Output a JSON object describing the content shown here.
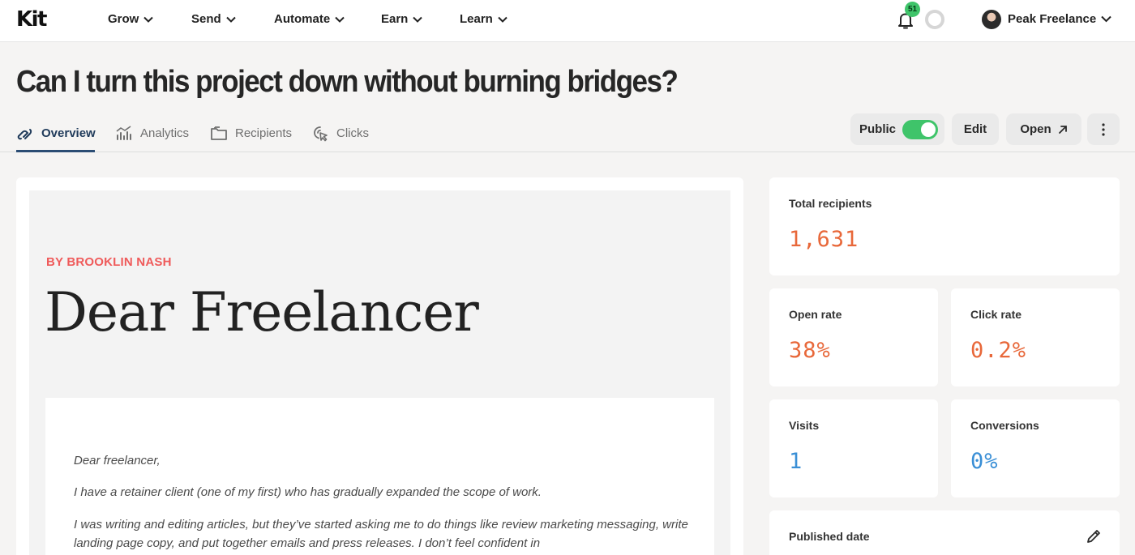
{
  "nav": {
    "logo": "Kit",
    "items": [
      {
        "label": "Grow"
      },
      {
        "label": "Send"
      },
      {
        "label": "Automate"
      },
      {
        "label": "Earn"
      },
      {
        "label": "Learn"
      }
    ],
    "notification_count": "51",
    "account_name": "Peak Freelance"
  },
  "page": {
    "title": "Can I turn this project down without burning bridges?"
  },
  "tabs": [
    {
      "label": "Overview",
      "icon": "link-icon",
      "active": true
    },
    {
      "label": "Analytics",
      "icon": "bar-chart-icon",
      "active": false
    },
    {
      "label": "Recipients",
      "icon": "folder-icon",
      "active": false
    },
    {
      "label": "Clicks",
      "icon": "cursor-click-icon",
      "active": false
    }
  ],
  "actions": {
    "public_label": "Public",
    "public_enabled": true,
    "edit_label": "Edit",
    "open_label": "Open"
  },
  "preview": {
    "byline": "BY BROOKLIN NASH",
    "heading": "Dear Freelancer",
    "paragraphs": [
      "Dear freelancer,",
      "I have a retainer client (one of my first) who has gradually expanded the scope of work.",
      "I was writing and editing articles, but they’ve started asking me to do things like review marketing messaging, write landing page copy, and put together emails and press releases. I don’t feel confident in"
    ]
  },
  "stats": {
    "total_recipients": {
      "label": "Total recipients",
      "value": "1,631"
    },
    "open_rate": {
      "label": "Open rate",
      "value": "38%"
    },
    "click_rate": {
      "label": "Click rate",
      "value": "0.2%"
    },
    "visits": {
      "label": "Visits",
      "value": "1"
    },
    "conversions": {
      "label": "Conversions",
      "value": "0%"
    },
    "published_date": {
      "label": "Published date"
    }
  },
  "colors": {
    "accent_green": "#3fc46a",
    "metric_orange": "#e8683a",
    "metric_blue": "#3a8fd6",
    "byline_red": "#ef5a5a",
    "tab_active": "#1f3a5a"
  }
}
